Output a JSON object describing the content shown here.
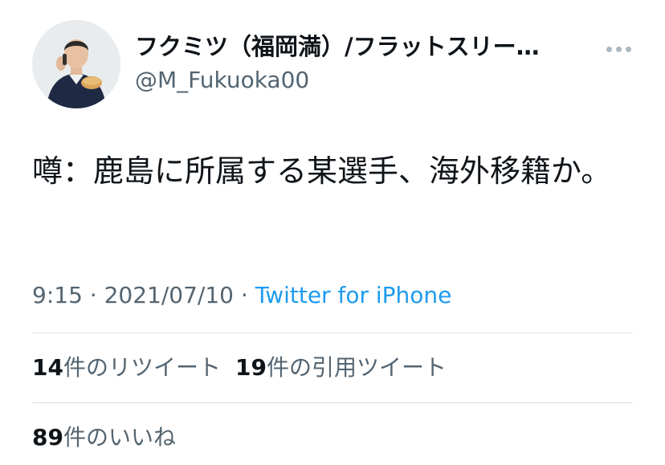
{
  "tweet": {
    "author": {
      "display_name": "フクミツ（福岡満）/フラットスリー…",
      "handle": "@M_Fukuoka00"
    },
    "text": "噂：鹿島に所属する某選手、海外移籍か。",
    "time": "9:15",
    "separator": "·",
    "date": "2021/07/10",
    "source": "Twitter for iPhone",
    "stats": {
      "retweets": {
        "count": "14",
        "label": "件のリツイート"
      },
      "quotes": {
        "count": "19",
        "label": "件の引用ツイート"
      },
      "likes": {
        "count": "89",
        "label": "件のいいね"
      }
    },
    "icons": {
      "more": "more-dots-icon",
      "avatar": "profile-photo"
    },
    "colors": {
      "link": "#1d9bf0",
      "secondary": "#536471",
      "text": "#0f1419"
    }
  }
}
